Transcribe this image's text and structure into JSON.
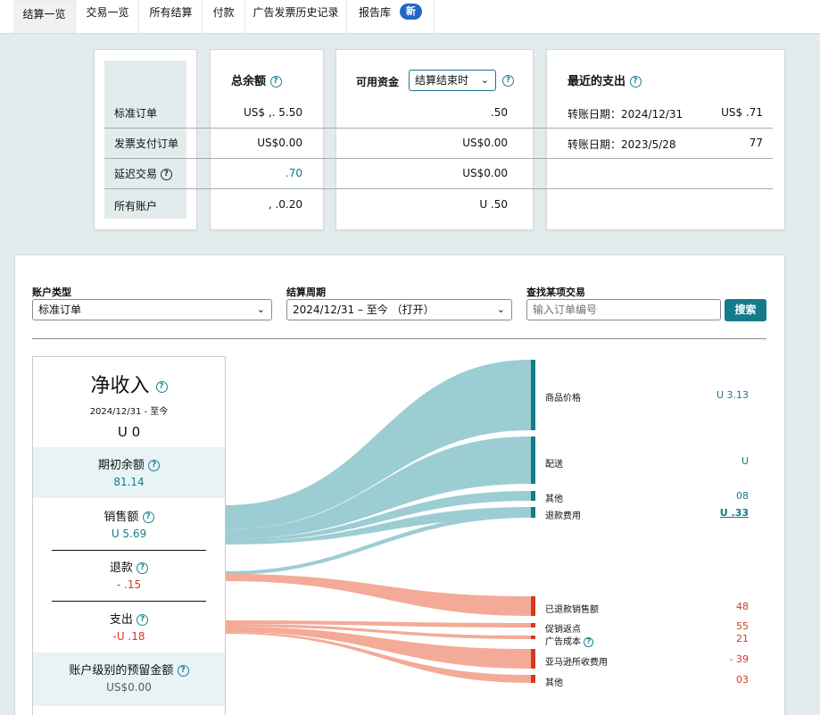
{
  "tabs": [
    {
      "label": "结算一览",
      "active": true
    },
    {
      "label": "交易一览",
      "active": false
    },
    {
      "label": "所有结算",
      "active": false
    },
    {
      "label": "付款",
      "active": false
    },
    {
      "label": "广告发票历史记录",
      "active": false
    },
    {
      "label": "报告库",
      "active": false
    }
  ],
  "new_badge": "新",
  "summary": {
    "rows": [
      "标准订单",
      "发票支付订单",
      "延迟交易",
      "所有账户"
    ],
    "total": {
      "header": "总余额",
      "values": [
        "US$ ,. 5.50",
        "US$0.00",
        " .70",
        " , .0.20"
      ]
    },
    "available": {
      "header": "可用资金",
      "select_value": "结算结束时",
      "values": [
        " .50",
        "US$0.00",
        "US$0.00",
        "U .50"
      ]
    },
    "recent": {
      "header": "最近的支出",
      "rows": [
        {
          "date": "转账日期：2024/12/31",
          "amount": "US$ .71"
        },
        {
          "date": "转账日期：2023/5/28",
          "amount": " 77"
        }
      ]
    }
  },
  "filters": {
    "account_type_label": "账户类型",
    "account_type_value": "标准订单",
    "period_label": "结算周期",
    "period_value": "2024/12/31 – 至今 （打开）",
    "find_label": "查找某项交易",
    "find_placeholder": "输入订单编号",
    "search_button": "搜索"
  },
  "net": {
    "title": "净收入",
    "date": "2024/12/31 - 至今",
    "value": "U  0",
    "items": [
      {
        "title": "期初余额",
        "value": "   81.14",
        "tone": "teal"
      },
      {
        "title": "销售额",
        "value": "U   5.69",
        "tone": "teal"
      },
      {
        "title": "退款",
        "value": "-  .15",
        "tone": "red"
      },
      {
        "title": "支出",
        "value": "-U   .18",
        "tone": "red"
      },
      {
        "title": "账户级别的预留金额",
        "value": "US$0.00",
        "tone": "gray"
      }
    ]
  },
  "flows": {
    "income": [
      {
        "label": "商品价格",
        "value": "U  3.13"
      },
      {
        "label": "配送",
        "value": "U  "
      },
      {
        "label": "其他",
        "value": "  08"
      },
      {
        "label": "退款费用",
        "value": "U  .33"
      }
    ],
    "expense": [
      {
        "label": "已退款销售额",
        "value": "  48"
      },
      {
        "label": "促销返点",
        "value": "  55"
      },
      {
        "label": "广告成本",
        "value": "  21"
      },
      {
        "label": "亚马逊所收费用",
        "value": "-  39"
      },
      {
        "label": "其他",
        "value": "  03"
      }
    ],
    "colors": {
      "income": "#9ccdd3",
      "income_bar": "#157a8a",
      "expense": "#f3ab98",
      "expense_bar": "#d63a1e"
    }
  }
}
